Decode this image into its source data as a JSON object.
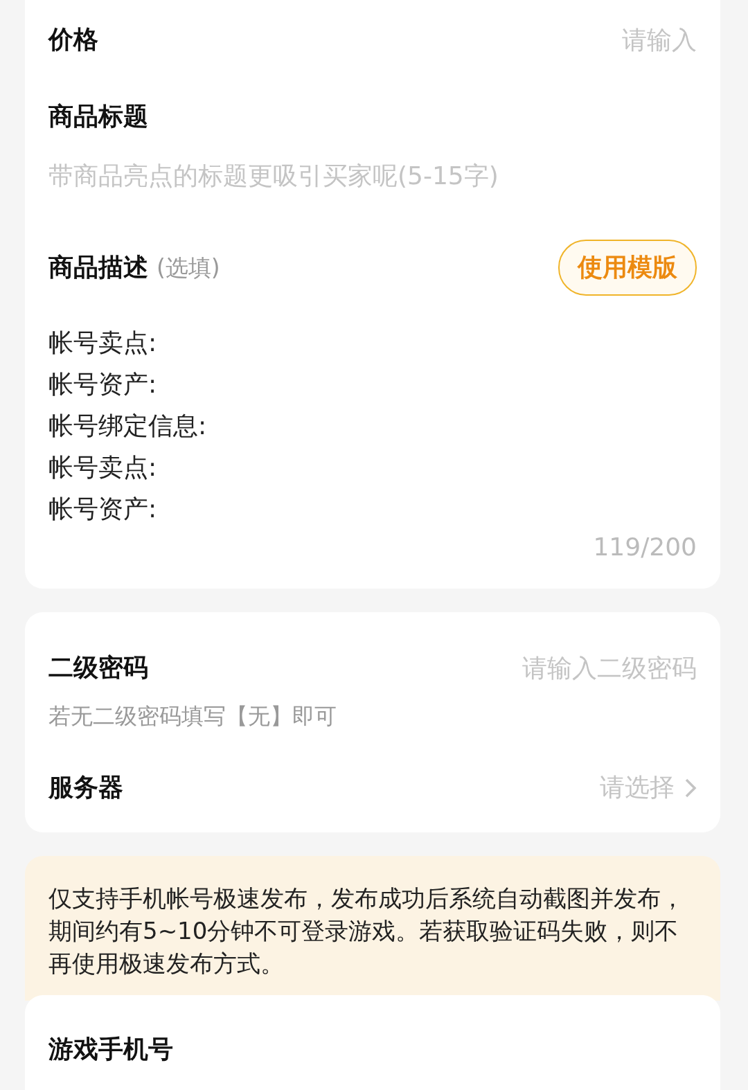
{
  "price": {
    "label": "价格",
    "placeholder": "请输入"
  },
  "title": {
    "label": "商品标题",
    "placeholder": "带商品亮点的标题更吸引买家呢(5-15字)"
  },
  "description": {
    "label": "商品描述",
    "hint": "(选填)",
    "template_button": "使用模版",
    "lines": [
      "帐号卖点:",
      "帐号资产:",
      "帐号绑定信息:",
      "帐号卖点:",
      "帐号资产:"
    ],
    "counter": "119/200"
  },
  "secondary_password": {
    "label": "二级密码",
    "placeholder": "请输入二级密码",
    "hint": "若无二级密码填写【无】即可"
  },
  "server": {
    "label": "服务器",
    "placeholder": "请选择"
  },
  "notice": "仅支持手机帐号极速发布，发布成功后系统自动截图并发布，期间约有5~10分钟不可登录游戏。若获取验证码失败，则不再使用极速发布方式。",
  "phone": {
    "label": "游戏手机号"
  }
}
